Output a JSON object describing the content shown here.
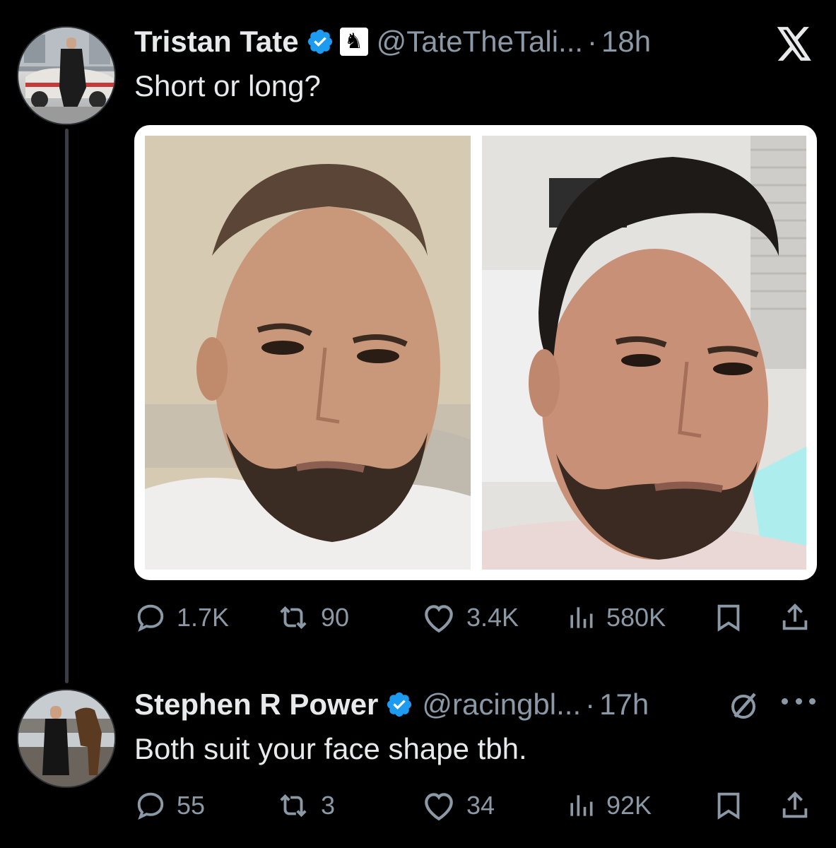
{
  "tweet": {
    "author": {
      "display_name": "Tristan Tate",
      "handle": "@TateTheTali...",
      "verified": true,
      "affiliate_badge_icon": "chess-knight-icon"
    },
    "time": "18h",
    "separator": "·",
    "text": "Short or long?",
    "media": [
      {
        "description_icon": "photo"
      },
      {
        "description_icon": "photo"
      }
    ],
    "actions": {
      "replies": "1.7K",
      "reposts": "90",
      "likes": "3.4K",
      "views": "580K"
    }
  },
  "reply": {
    "author": {
      "display_name": "Stephen R Power",
      "handle": "@racingbl...",
      "verified": true
    },
    "time": "17h",
    "separator": "·",
    "text": "Both suit your face shape tbh.",
    "actions": {
      "replies": "55",
      "reposts": "3",
      "likes": "34",
      "views": "92K"
    }
  },
  "icons": {
    "verified_color": "#1d9bf0",
    "logo": "x-logo-icon",
    "more": "more-icon",
    "grok": "grok-icon"
  },
  "colors": {
    "background": "#000000",
    "text_primary": "#e7e9ea",
    "text_secondary": "#8b98a5",
    "thread_line": "#3a3d41"
  }
}
